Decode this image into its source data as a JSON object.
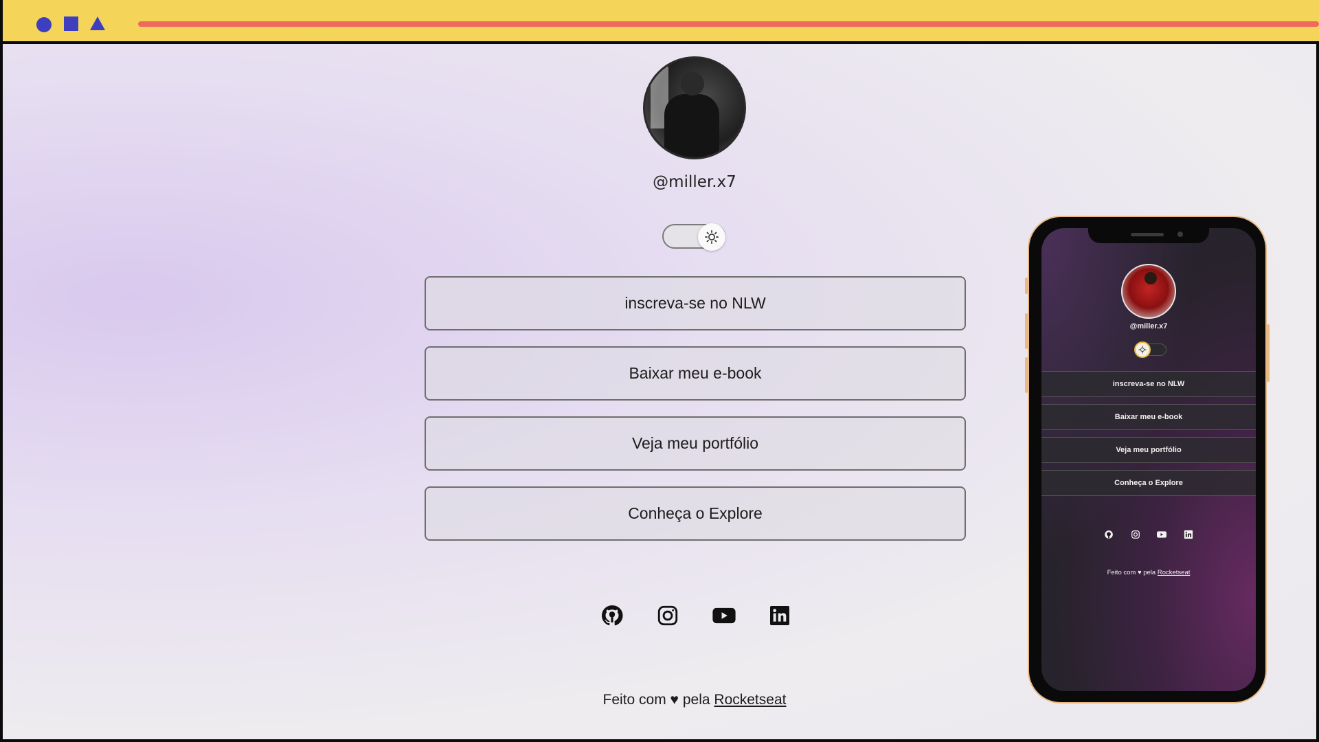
{
  "profile": {
    "username": "@miller.x7"
  },
  "links": [
    {
      "label": "inscreva-se no NLW"
    },
    {
      "label": "Baixar meu e-book"
    },
    {
      "label": "Veja meu portfólio"
    },
    {
      "label": "Conheça o Explore"
    }
  ],
  "socials": [
    {
      "icon": "github-icon"
    },
    {
      "icon": "instagram-icon"
    },
    {
      "icon": "youtube-icon"
    },
    {
      "icon": "linkedin-icon"
    }
  ],
  "footer": {
    "prefix": "Feito com ♥ pela",
    "link": "Rocketseat"
  },
  "phone_preview": {
    "username": "@miller.x7",
    "links": [
      {
        "label": "inscreva-se no NLW"
      },
      {
        "label": "Baixar meu e-book"
      },
      {
        "label": "Veja meu portfólio"
      },
      {
        "label": "Conheça o Explore"
      }
    ],
    "footer_prefix": "Feito com ♥ pela",
    "footer_link": "Rocketseat"
  },
  "colors": {
    "topbar": "#f4d55a",
    "shapes": "#3d3fbf",
    "addressbar": "#ef6a5c",
    "phone_frame_accent": "#e9b984"
  }
}
